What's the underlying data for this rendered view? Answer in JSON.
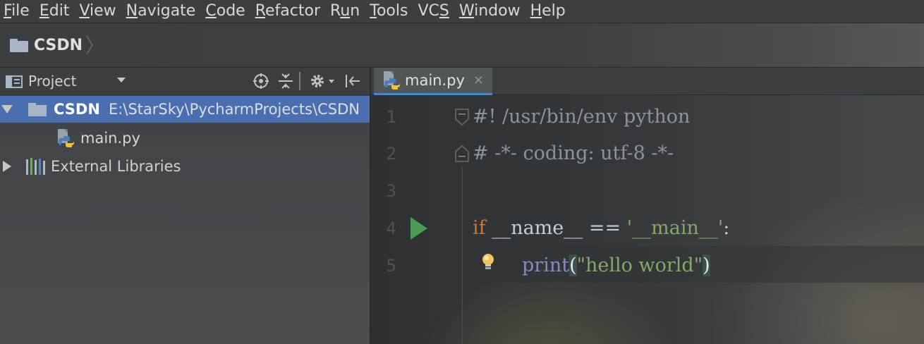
{
  "menu": {
    "items": [
      {
        "mnemonic": "F",
        "rest": "ile"
      },
      {
        "mnemonic": "E",
        "rest": "dit"
      },
      {
        "mnemonic": "V",
        "rest": "iew"
      },
      {
        "mnemonic": "N",
        "rest": "avigate"
      },
      {
        "mnemonic": "C",
        "rest": "ode"
      },
      {
        "mnemonic": "R",
        "rest": "efactor"
      },
      {
        "pre": "R",
        "mnemonic": "u",
        "rest": "n"
      },
      {
        "mnemonic": "T",
        "rest": "ools"
      },
      {
        "pre": "VC",
        "mnemonic": "S",
        "rest": ""
      },
      {
        "mnemonic": "W",
        "rest": "indow"
      },
      {
        "mnemonic": "H",
        "rest": "elp"
      }
    ]
  },
  "navbar": {
    "crumb": "CSDN"
  },
  "project_panel": {
    "title": "Project",
    "tree": {
      "root_name": "CSDN",
      "root_path": "E:\\StarSky\\PycharmProjects\\CSDN",
      "file": "main.py",
      "libraries": "External Libraries"
    }
  },
  "editor": {
    "tab": "main.py",
    "line_numbers": [
      "1",
      "2",
      "3",
      "4",
      "5"
    ],
    "code": {
      "line1": "#! /usr/bin/env python",
      "line2": "# -*- coding: utf-8 -*-",
      "line4_kw": "if",
      "line4_mid": " __name__ == ",
      "line4_str": "'__main__'",
      "line4_end": ":",
      "line5_func": "print",
      "line5_open": "(",
      "line5_str": "\"hello world\"",
      "line5_close": ")"
    }
  },
  "colors": {
    "selection": "#4b6eaf",
    "keyword": "#cc7832",
    "string": "#87a765",
    "builtin": "#8888c6",
    "run_arrow": "#499c54"
  }
}
